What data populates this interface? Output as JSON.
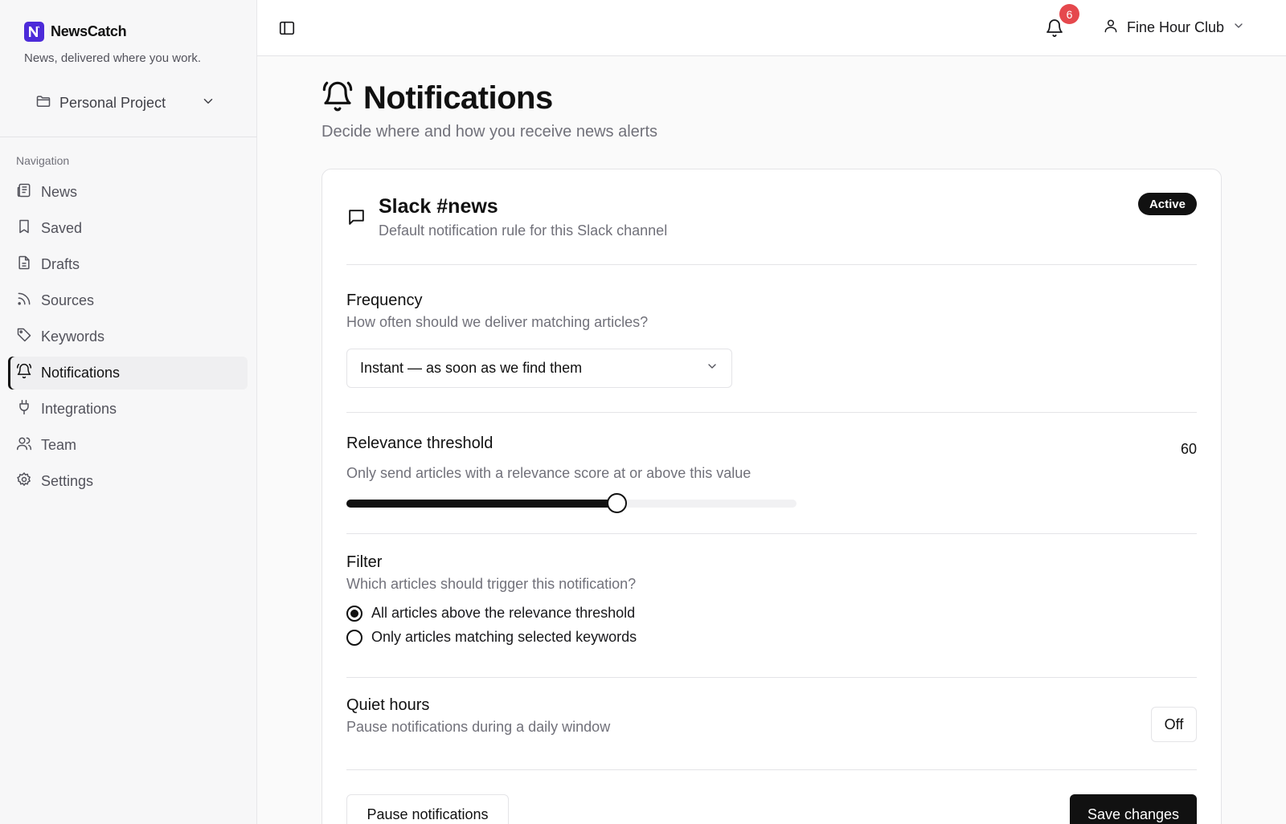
{
  "brand": {
    "name": "NewsCatch",
    "tagline": "News, delivered where you work."
  },
  "project": {
    "label": "Personal Project"
  },
  "nav": {
    "heading": "Navigation",
    "items": [
      {
        "label": "News",
        "icon": "newspaper-icon"
      },
      {
        "label": "Saved",
        "icon": "bookmark-icon"
      },
      {
        "label": "Drafts",
        "icon": "file-text-icon"
      },
      {
        "label": "Sources",
        "icon": "rss-icon"
      },
      {
        "label": "Keywords",
        "icon": "tag-icon"
      },
      {
        "label": "Notifications",
        "icon": "bell-ring-icon",
        "active": true
      },
      {
        "label": "Integrations",
        "icon": "plug-icon"
      },
      {
        "label": "Team",
        "icon": "users-icon"
      },
      {
        "label": "Settings",
        "icon": "gear-icon"
      }
    ]
  },
  "topbar": {
    "notification_count": "6",
    "user_name": "Fine Hour Club"
  },
  "page": {
    "title": "Notifications",
    "subtitle": "Decide where and how you receive news alerts"
  },
  "card": {
    "title": "Slack #news",
    "description": "Default notification rule for this Slack channel",
    "status": "Active",
    "frequency": {
      "title": "Frequency",
      "description": "How often should we deliver matching articles?",
      "selected": "Instant — as soon as we find them"
    },
    "threshold": {
      "title": "Relevance threshold",
      "description": "Only send articles with a relevance score at or above this value",
      "value": "60",
      "percent": 60
    },
    "filter": {
      "title": "Filter",
      "description": "Which articles should trigger this notification?",
      "options": [
        {
          "label": "All articles above the relevance threshold",
          "selected": true
        },
        {
          "label": "Only articles matching selected keywords",
          "selected": false
        }
      ]
    },
    "quiet_hours": {
      "title": "Quiet hours",
      "description": "Pause notifications during a daily window",
      "toggle_label": "Off"
    },
    "actions": {
      "pause_label": "Pause notifications",
      "save_label": "Save changes"
    }
  },
  "colors": {
    "brand": "#4c2bd9",
    "primary": "#111111",
    "badge": "#e5484d"
  }
}
